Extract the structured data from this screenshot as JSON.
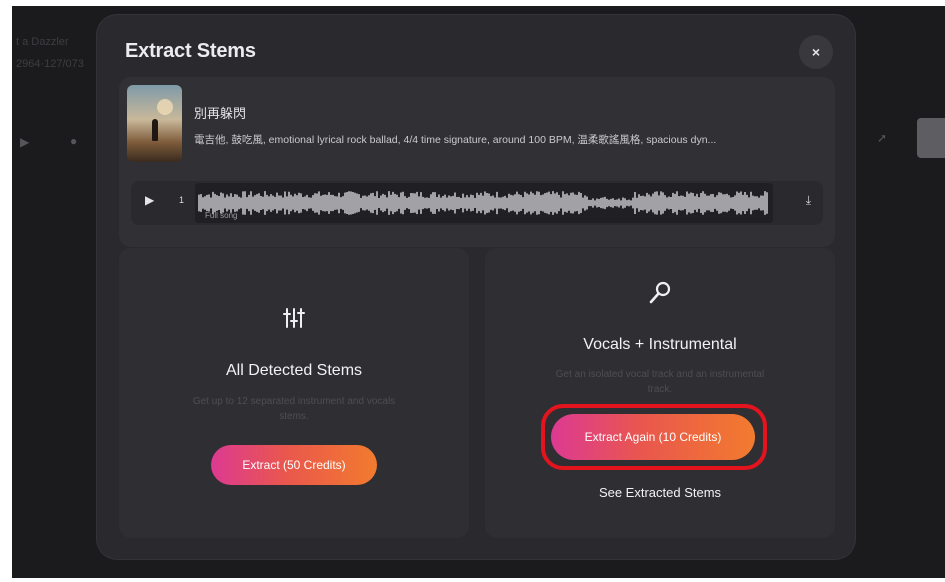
{
  "background": {
    "text_line_1": "t a Dazzler",
    "text_line_2": "2964·127/073"
  },
  "modal": {
    "title": "Extract Stems",
    "close_glyph": "×"
  },
  "track": {
    "title": "別再躲閃",
    "description": "電吉他, 鼓吃風, emotional lyrical rock ballad, 4/4 time signature, around 100 BPM, 温柔歌謠風格, spacious dyn...",
    "speed": "1",
    "waveform_caption": "Full song"
  },
  "options": {
    "all_stems": {
      "title": "All Detected Stems",
      "subtitle": "Get up to 12 separated instrument and vocals stems.",
      "button": "Extract (50 Credits)"
    },
    "vocals": {
      "title": "Vocals + Instrumental",
      "subtitle": "Get an isolated vocal track and an instrumental track.",
      "button": "Extract Again (10 Credits)",
      "link": "See Extracted Stems"
    }
  },
  "colors": {
    "highlight": "#e3141e",
    "gradient_start": "#dc3a92",
    "gradient_end": "#f27b2e"
  }
}
